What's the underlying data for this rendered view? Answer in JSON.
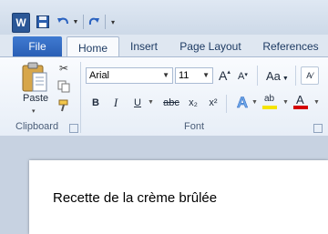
{
  "qat": {
    "app_icon": "W",
    "save_icon": "save-icon",
    "undo_icon": "undo-icon",
    "redo_icon": "redo-icon"
  },
  "tabs": {
    "file": "File",
    "home": "Home",
    "insert": "Insert",
    "page_layout": "Page Layout",
    "references": "References"
  },
  "ribbon": {
    "clipboard": {
      "paste_label": "Paste",
      "group_label": "Clipboard"
    },
    "font": {
      "font_name": "Arial",
      "font_size": "11",
      "grow_font": "A",
      "shrink_font": "A",
      "change_case": "Aa",
      "bold": "B",
      "italic": "I",
      "underline": "U",
      "strikethrough": "abc",
      "subscript": "x₂",
      "superscript": "x²",
      "highlight": "ab",
      "font_color": "A",
      "group_label": "Font"
    }
  },
  "document": {
    "text": "Recette de la crème brûlée"
  },
  "colors": {
    "file_tab": "#2a5fb5",
    "highlight_yellow": "#f5e400",
    "font_color_red": "#d40000"
  }
}
